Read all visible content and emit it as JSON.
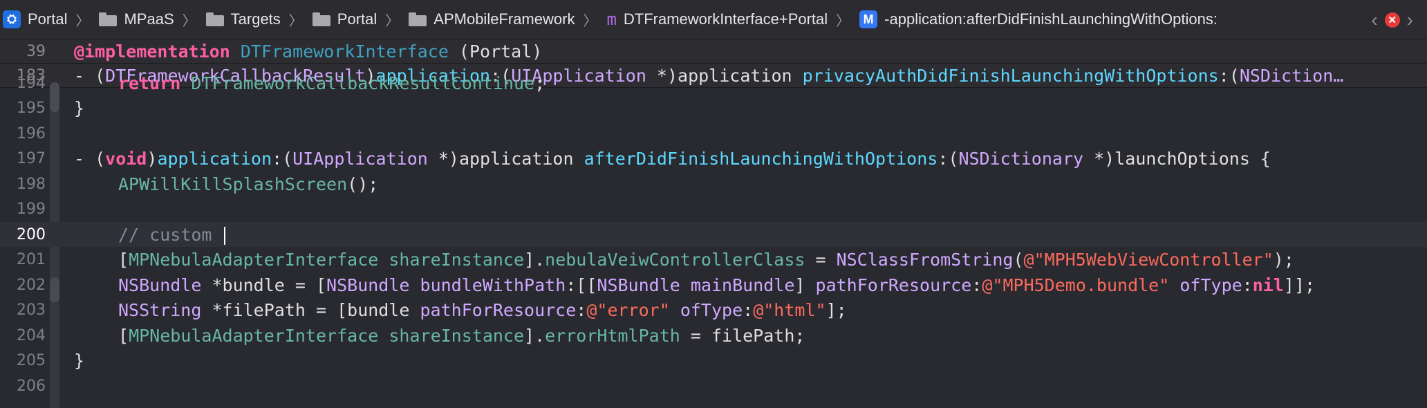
{
  "breadcrumb": {
    "items": [
      {
        "label": "Portal",
        "icon": "app-icon"
      },
      {
        "label": "MPaaS",
        "icon": "folder-icon"
      },
      {
        "label": "Targets",
        "icon": "folder-icon"
      },
      {
        "label": "Portal",
        "icon": "folder-icon"
      },
      {
        "label": "APMobileFramework",
        "icon": "folder-icon"
      },
      {
        "label": "DTFrameworkInterface+Portal",
        "icon": "m-file-icon"
      },
      {
        "label": "-application:afterDidFinishLaunchingWithOptions:",
        "icon": "method-icon"
      }
    ],
    "separator": "〉",
    "back_glyph": "‹",
    "error_glyph": "✕",
    "forward_glyph": "›"
  },
  "sticky_headers": [
    {
      "line": "39",
      "tokens": [
        {
          "t": "@implementation",
          "c": "kw"
        },
        {
          "t": " ",
          "c": "pl"
        },
        {
          "t": "DTFrameworkInterface",
          "c": "prj"
        },
        {
          "t": " (Portal)",
          "c": "pl"
        }
      ]
    },
    {
      "line": "183",
      "tokens": [
        {
          "t": "- (",
          "c": "pl"
        },
        {
          "t": "DTFrameworkCallbackResult",
          "c": "ty"
        },
        {
          "t": ")",
          "c": "pl"
        },
        {
          "t": "application",
          "c": "sel"
        },
        {
          "t": ":(",
          "c": "pl"
        },
        {
          "t": "UIApplication",
          "c": "ty"
        },
        {
          "t": " *)application ",
          "c": "pl"
        },
        {
          "t": "privacyAuthDidFinishLaunchingWithOptions",
          "c": "sel"
        },
        {
          "t": ":(",
          "c": "pl"
        },
        {
          "t": "NSDiction…",
          "c": "ty"
        }
      ]
    }
  ],
  "code_lines": [
    {
      "line": "194",
      "indent": 1,
      "tokens": [
        {
          "t": "return",
          "c": "kw"
        },
        {
          "t": " ",
          "c": "pl"
        },
        {
          "t": "DTFrameworkCallbackResultContinue",
          "c": "fn"
        },
        {
          "t": ";",
          "c": "pl"
        }
      ]
    },
    {
      "line": "195",
      "indent": 0,
      "tokens": [
        {
          "t": "}",
          "c": "pl"
        }
      ]
    },
    {
      "line": "196",
      "indent": 0,
      "tokens": []
    },
    {
      "line": "197",
      "indent": 0,
      "tokens": [
        {
          "t": "- (",
          "c": "pl"
        },
        {
          "t": "void",
          "c": "kw"
        },
        {
          "t": ")",
          "c": "pl"
        },
        {
          "t": "application",
          "c": "sel"
        },
        {
          "t": ":(",
          "c": "pl"
        },
        {
          "t": "UIApplication",
          "c": "ty"
        },
        {
          "t": " *)application ",
          "c": "pl"
        },
        {
          "t": "afterDidFinishLaunchingWithOptions",
          "c": "sel"
        },
        {
          "t": ":(",
          "c": "pl"
        },
        {
          "t": "NSDictionary",
          "c": "ty"
        },
        {
          "t": " *)launchOptions {",
          "c": "pl"
        }
      ]
    },
    {
      "line": "198",
      "indent": 1,
      "tokens": [
        {
          "t": "APWillKillSplashScreen",
          "c": "fn"
        },
        {
          "t": "();",
          "c": "pl"
        }
      ]
    },
    {
      "line": "199",
      "indent": 0,
      "tokens": []
    },
    {
      "line": "200",
      "indent": 1,
      "current": true,
      "tokens": [
        {
          "t": "// custom ",
          "c": "cm"
        }
      ]
    },
    {
      "line": "201",
      "indent": 1,
      "tokens": [
        {
          "t": "[",
          "c": "pl"
        },
        {
          "t": "MPNebulaAdapterInterface",
          "c": "fn"
        },
        {
          "t": " ",
          "c": "pl"
        },
        {
          "t": "shareInstance",
          "c": "fn"
        },
        {
          "t": "].",
          "c": "pl"
        },
        {
          "t": "nebulaVeiwControllerClass",
          "c": "fn"
        },
        {
          "t": " = ",
          "c": "pl"
        },
        {
          "t": "NSClassFromString",
          "c": "ty"
        },
        {
          "t": "(",
          "c": "pl"
        },
        {
          "t": "@\"MPH5WebViewController\"",
          "c": "str"
        },
        {
          "t": ");",
          "c": "pl"
        }
      ]
    },
    {
      "line": "202",
      "indent": 1,
      "tokens": [
        {
          "t": "NSBundle",
          "c": "ty"
        },
        {
          "t": " *bundle = [",
          "c": "pl"
        },
        {
          "t": "NSBundle",
          "c": "ty"
        },
        {
          "t": " ",
          "c": "pl"
        },
        {
          "t": "bundleWithPath",
          "c": "ty"
        },
        {
          "t": ":[[",
          "c": "pl"
        },
        {
          "t": "NSBundle",
          "c": "ty"
        },
        {
          "t": " ",
          "c": "pl"
        },
        {
          "t": "mainBundle",
          "c": "ty"
        },
        {
          "t": "] ",
          "c": "pl"
        },
        {
          "t": "pathForResource",
          "c": "ty"
        },
        {
          "t": ":",
          "c": "pl"
        },
        {
          "t": "@\"MPH5Demo.bundle\"",
          "c": "str"
        },
        {
          "t": " ",
          "c": "pl"
        },
        {
          "t": "ofType",
          "c": "ty"
        },
        {
          "t": ":",
          "c": "pl"
        },
        {
          "t": "nil",
          "c": "kw"
        },
        {
          "t": "]];",
          "c": "pl"
        }
      ]
    },
    {
      "line": "203",
      "indent": 1,
      "tokens": [
        {
          "t": "NSString",
          "c": "ty"
        },
        {
          "t": " *filePath = [bundle ",
          "c": "pl"
        },
        {
          "t": "pathForResource",
          "c": "ty"
        },
        {
          "t": ":",
          "c": "pl"
        },
        {
          "t": "@\"error\"",
          "c": "str"
        },
        {
          "t": " ",
          "c": "pl"
        },
        {
          "t": "ofType",
          "c": "ty"
        },
        {
          "t": ":",
          "c": "pl"
        },
        {
          "t": "@\"html\"",
          "c": "str"
        },
        {
          "t": "];",
          "c": "pl"
        }
      ]
    },
    {
      "line": "204",
      "indent": 1,
      "tokens": [
        {
          "t": "[",
          "c": "pl"
        },
        {
          "t": "MPNebulaAdapterInterface",
          "c": "fn"
        },
        {
          "t": " ",
          "c": "pl"
        },
        {
          "t": "shareInstance",
          "c": "fn"
        },
        {
          "t": "].",
          "c": "pl"
        },
        {
          "t": "errorHtmlPath",
          "c": "fn"
        },
        {
          "t": " = filePath;",
          "c": "pl"
        }
      ]
    },
    {
      "line": "205",
      "indent": 0,
      "tokens": [
        {
          "t": "}",
          "c": "pl"
        }
      ]
    },
    {
      "line": "206",
      "indent": 0,
      "tokens": []
    }
  ],
  "colors": {
    "keyword": "#fc5fa3",
    "type": "#d0a8ff",
    "function": "#67b7a4",
    "selector": "#5dd8ff",
    "string": "#fc6a5d",
    "comment": "#7f8c98",
    "background": "#292a30"
  }
}
